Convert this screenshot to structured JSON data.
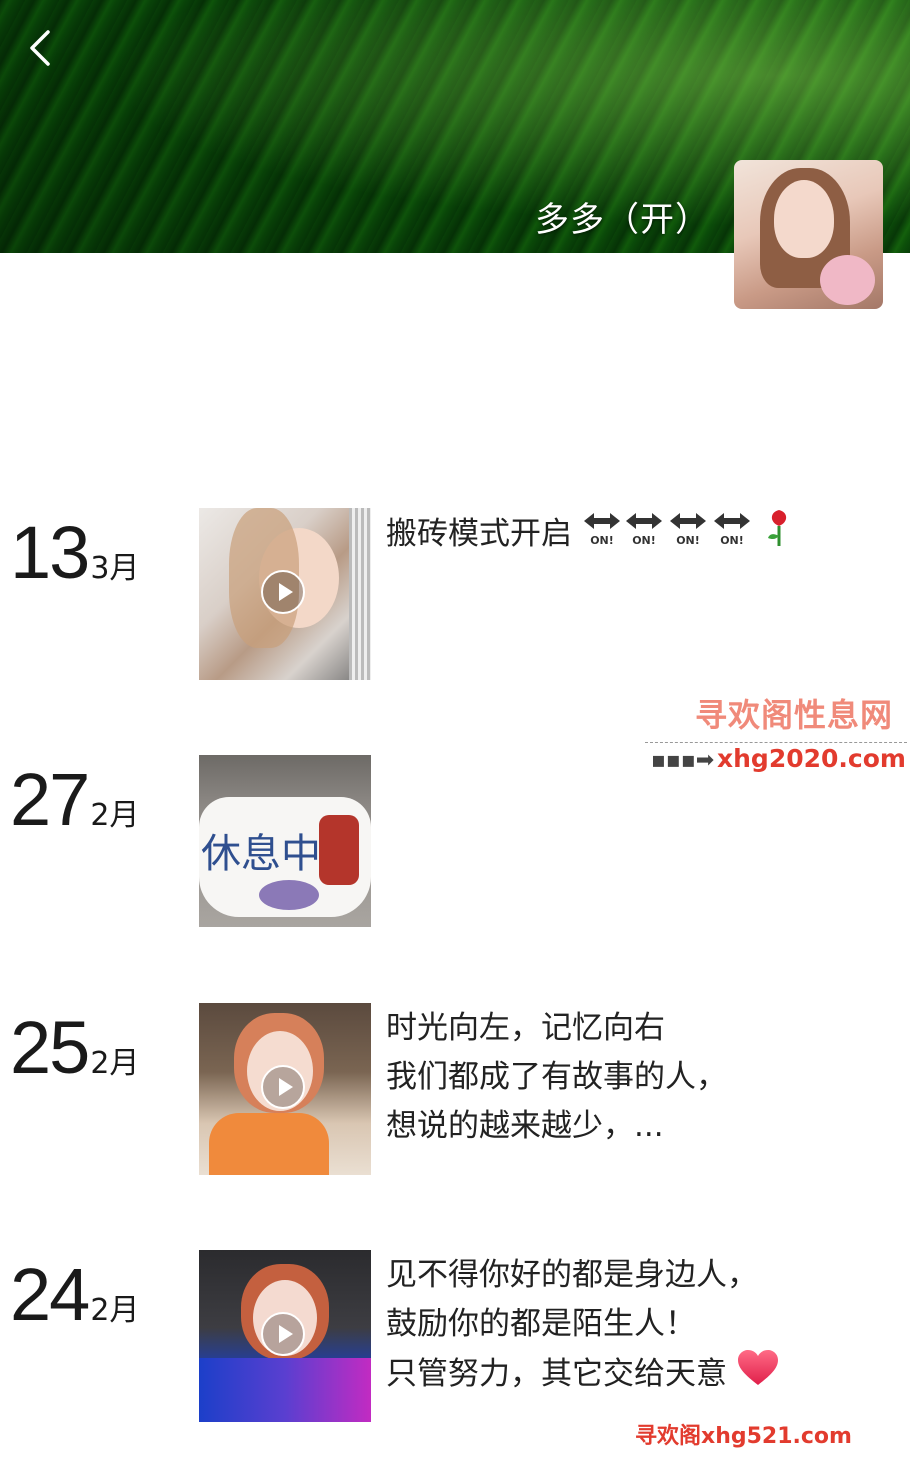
{
  "header": {
    "username": "多多（开）",
    "colors": {
      "cover_green": "#2f8a2e"
    }
  },
  "icons": {
    "back": "chevron-left-icon",
    "play": "play-icon",
    "arrow_lr": "left-right-arrow-on-icon",
    "rose": "rose-icon",
    "heart": "heart-icon"
  },
  "posts": [
    {
      "day": "13",
      "month": "3月",
      "has_video": true,
      "thumb_desc": "selfie",
      "caption_lines": [
        "搬砖模式开启"
      ]
    },
    {
      "day": "27",
      "month": "2月",
      "has_video": false,
      "thumb_text": "休息中",
      "caption_lines": []
    },
    {
      "day": "25",
      "month": "2月",
      "has_video": true,
      "caption_lines": [
        "时光向左，记忆向右",
        "我们都成了有故事的人，",
        "想说的越来越少，..."
      ]
    },
    {
      "day": "24",
      "month": "2月",
      "has_video": true,
      "caption_lines": [
        "见不得你好的都是身边人，",
        "鼓励你的都是陌生人！",
        "只管努力，其它交给天意"
      ]
    }
  ],
  "arrow_label": "ON!",
  "watermarks": {
    "title": "寻欢阁性息网",
    "url": "xhg2020.com",
    "bottom": "寻欢阁xhg521.com"
  }
}
